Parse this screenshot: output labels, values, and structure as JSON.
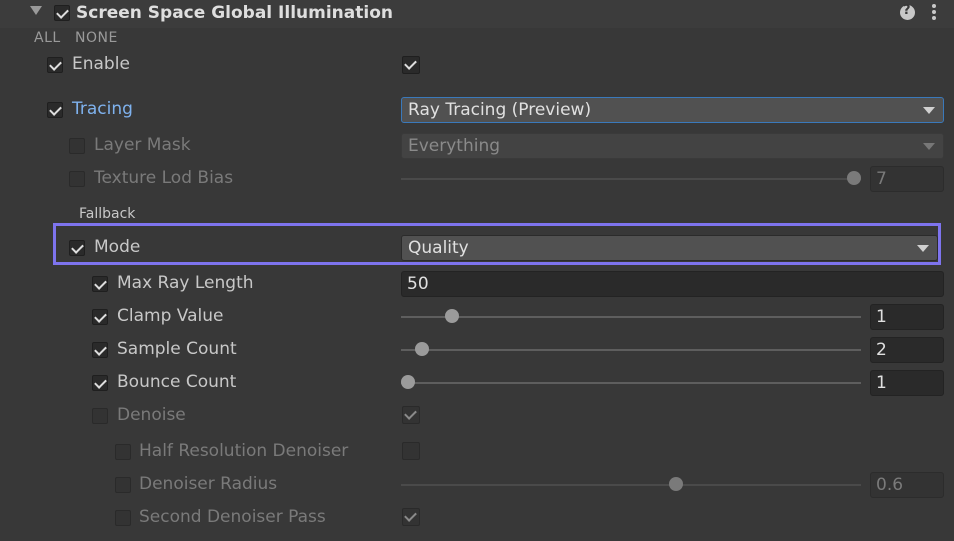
{
  "header": {
    "title": "Screen Space Global Illumination",
    "enabled": true
  },
  "quick": {
    "all": "ALL",
    "none": "NONE"
  },
  "rows": {
    "enable": {
      "label": "Enable",
      "override": true,
      "value": true
    },
    "tracing": {
      "label": "Tracing",
      "override": true,
      "value": "Ray Tracing (Preview)"
    },
    "layer_mask": {
      "label": "Layer Mask",
      "override": false,
      "value": "Everything"
    },
    "texture_lod_bias": {
      "label": "Texture Lod Bias",
      "override": false,
      "value": "7",
      "slider_fraction": 1.0
    },
    "fallback": {
      "section": "Fallback"
    },
    "mode": {
      "label": "Mode",
      "override": true,
      "value": "Quality"
    },
    "max_ray_length": {
      "label": "Max Ray Length",
      "override": true,
      "value": "50"
    },
    "clamp_value": {
      "label": "Clamp Value",
      "override": true,
      "value": "1",
      "slider_fraction": 0.11
    },
    "sample_count": {
      "label": "Sample Count",
      "override": true,
      "value": "2",
      "slider_fraction": 0.03
    },
    "bounce_count": {
      "label": "Bounce Count",
      "override": true,
      "value": "1",
      "slider_fraction": 0.0
    },
    "denoise": {
      "label": "Denoise",
      "override": false,
      "value": true
    },
    "half_resolution_denoiser": {
      "label": "Half Resolution Denoiser",
      "override": false,
      "value": false
    },
    "denoiser_radius": {
      "label": "Denoiser Radius",
      "override": false,
      "value": "0.6",
      "slider_fraction": 0.6
    },
    "second_denoiser_pass": {
      "label": "Second Denoiser Pass",
      "override": false,
      "value": true
    }
  },
  "icons": {
    "help": "question-circle-icon",
    "menu": "kebab-menu-icon"
  },
  "colors": {
    "accent": "#7fb2ee",
    "highlight": "#7e74ee"
  }
}
